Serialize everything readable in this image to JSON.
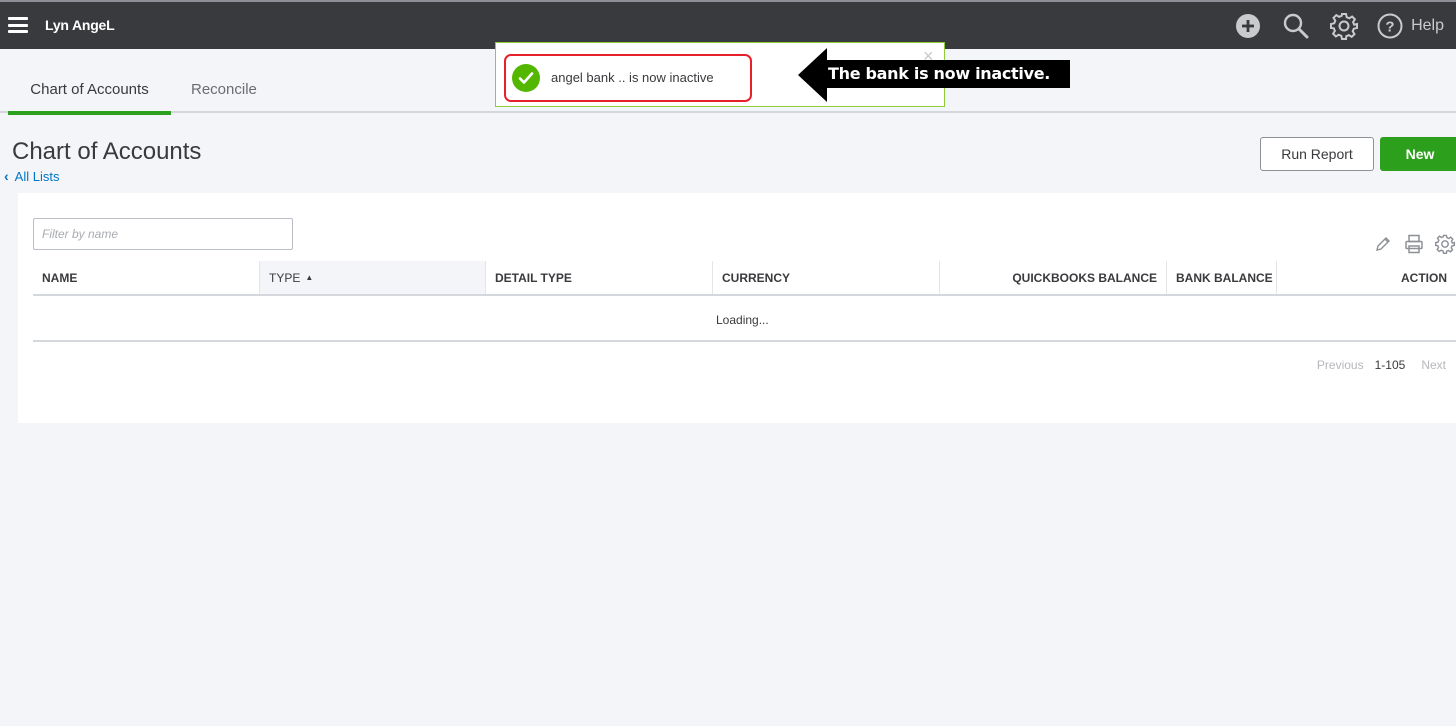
{
  "topbar": {
    "company_name": "Lyn AngeL",
    "icons": [
      "plus-circle-icon",
      "search-icon",
      "gear-icon",
      "help-icon"
    ],
    "help_label": "Help"
  },
  "tabs": [
    {
      "label": "Chart of Accounts",
      "active": true
    },
    {
      "label": "Reconcile",
      "active": false
    }
  ],
  "toast": {
    "icon": "check-circle-icon",
    "message": "angel bank .. is now inactive",
    "close_glyph": "×",
    "success_color": "#53b700"
  },
  "annotation": {
    "text": "The bank is now inactive."
  },
  "page": {
    "title": "Chart of Accounts",
    "back_link": "All Lists",
    "back_glyph": "‹"
  },
  "actions": {
    "run_report": "Run Report",
    "new": "New",
    "accent_color": "#2ca01c"
  },
  "filter": {
    "placeholder": "Filter by name",
    "value": ""
  },
  "table": {
    "tool_icons": [
      "pencil-icon",
      "printer-icon",
      "gear-icon"
    ],
    "columns": [
      {
        "label": "NAME"
      },
      {
        "label": "TYPE",
        "sorted": "ascending",
        "sort_glyph": "▲"
      },
      {
        "label": "DETAIL TYPE"
      },
      {
        "label": "CURRENCY"
      },
      {
        "label": "QUICKBOOKS BALANCE"
      },
      {
        "label": "BANK BALANCE"
      },
      {
        "label": "ACTION"
      }
    ],
    "status_text": "Loading..."
  },
  "pagination": {
    "previous": "Previous",
    "range": "1-105",
    "next": "Next"
  }
}
